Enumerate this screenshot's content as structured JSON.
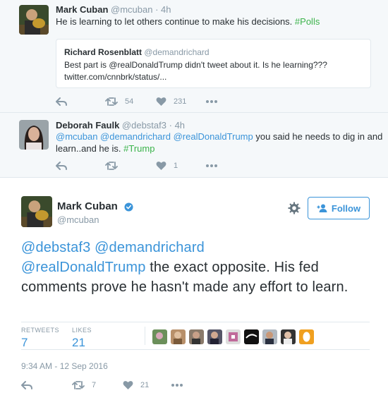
{
  "tweet1": {
    "name": "Mark Cuban",
    "handle": "@mcuban",
    "time": "· 4h",
    "text": "He is learning to let others continue to make his decisions.",
    "hashtag": "#Polls",
    "quote": {
      "name": "Richard Rosenblatt",
      "handle": "@demandrichard",
      "text_line1": "Best part is @realDonaldTrump didn't tweet about it. Is he learning???",
      "text_line2": "twitter.com/cnnbrk/status/..."
    },
    "retweets": "54",
    "likes": "231"
  },
  "tweet2": {
    "name": "Deborah Faulk",
    "handle": "@debstaf3",
    "time": "· 4h",
    "mentions": "@mcuban @demandrichard @realDonaldTrump",
    "text_rest": " you said he needs to dig in and",
    "text_line2": "learn..and he is. ",
    "hashtag": "#Trump",
    "retweets": "",
    "likes": "1"
  },
  "main": {
    "name": "Mark Cuban",
    "handle": "@mcuban",
    "follow_label": "Follow",
    "mention_line1": "@debstaf3 @demandrichard",
    "mention_line2": "@realDonaldTrump",
    "text_after_mention": " the exact opposite. His fed comments prove he hasn't made any effort to learn.",
    "retweets_label": "RETWEETS",
    "retweets": "7",
    "likes_label": "LIKES",
    "likes": "21",
    "timestamp": "9:34 AM - 12 Sep 2016",
    "action_retweets": "7",
    "action_likes": "21"
  },
  "colors": {
    "link": "#3b94d9",
    "hashtag": "#3bb34b",
    "muted": "#8899a6",
    "context_bg": "#f5f8fa"
  },
  "icons": [
    "reply-icon",
    "retweet-icon",
    "heart-icon",
    "more-icon",
    "gear-icon",
    "verified-icon",
    "follow-person-icon"
  ]
}
